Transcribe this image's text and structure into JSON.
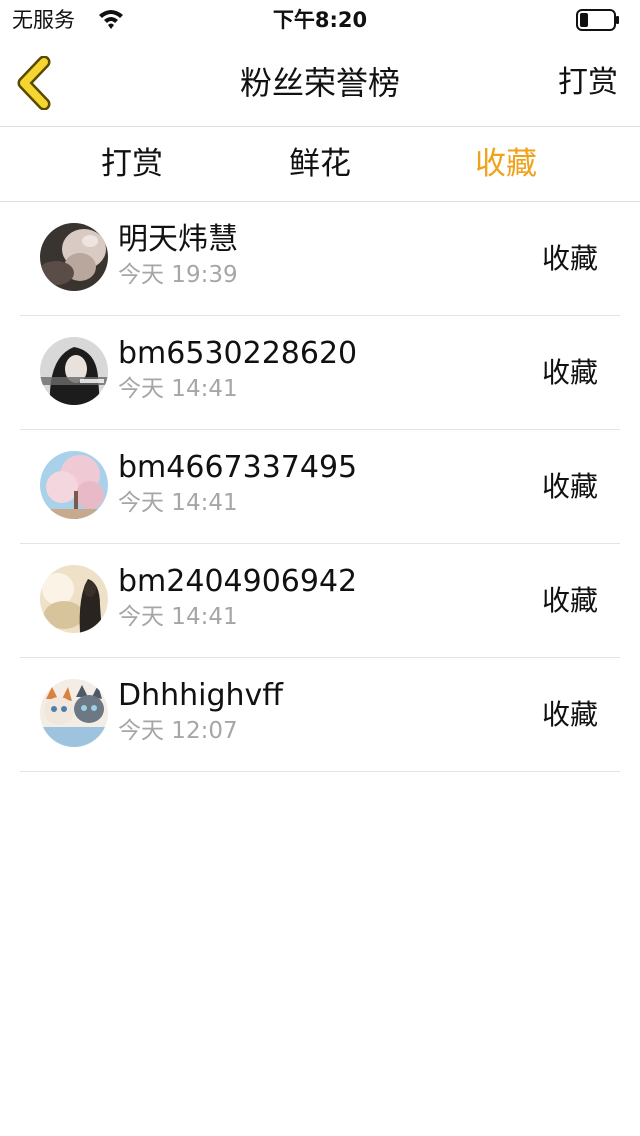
{
  "status_bar": {
    "carrier": "无服务",
    "time": "下午8:20",
    "icons": [
      "wifi-icon",
      "battery-icon"
    ],
    "battery_level": 0.25
  },
  "nav": {
    "title": "粉丝荣誉榜",
    "right_label": "打赏",
    "back_icon": "chevron-left-icon",
    "accent_color": "#f0a21b"
  },
  "tabs": [
    {
      "label": "打赏",
      "active": false
    },
    {
      "label": "鲜花",
      "active": false
    },
    {
      "label": "收藏",
      "active": true
    }
  ],
  "list": [
    {
      "name": "明天炜慧",
      "time": "今天 19:39",
      "action": "收藏"
    },
    {
      "name": "bm6530228620",
      "time": "今天 14:41",
      "action": "收藏"
    },
    {
      "name": "bm4667337495",
      "time": "今天 14:41",
      "action": "收藏"
    },
    {
      "name": "bm2404906942",
      "time": "今天 14:41",
      "action": "收藏"
    },
    {
      "name": "Dhhhighvff",
      "time": "今天 12:07",
      "action": "收藏"
    }
  ]
}
